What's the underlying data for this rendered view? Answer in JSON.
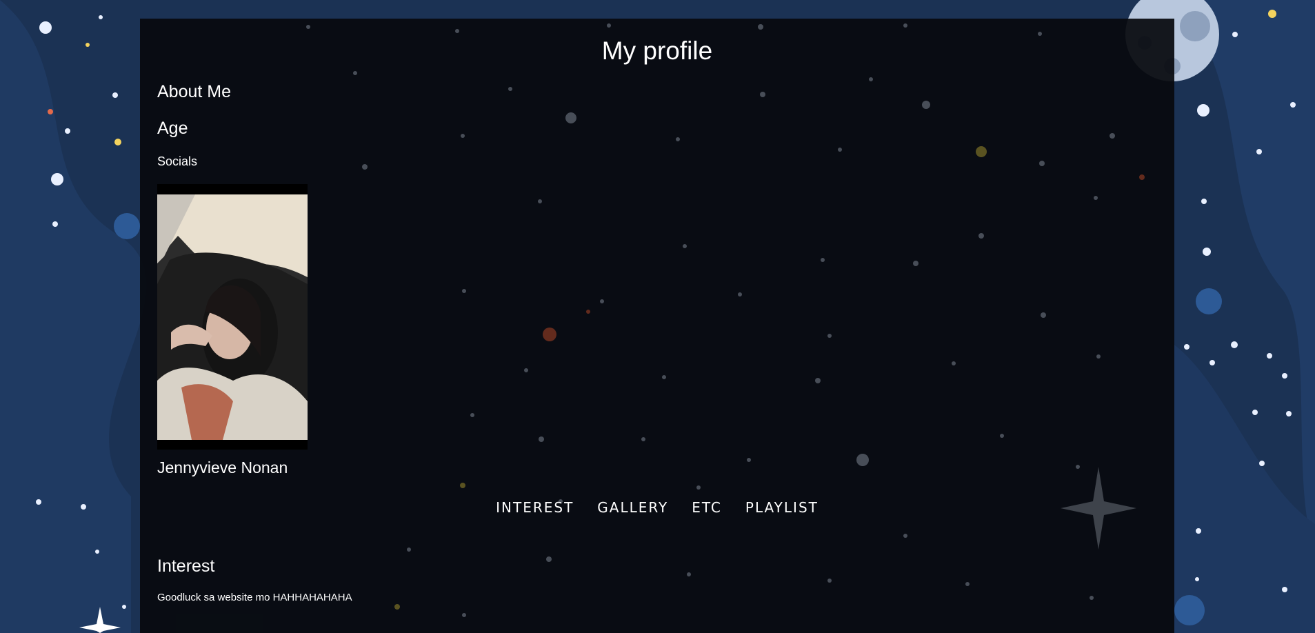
{
  "page": {
    "title": "My profile",
    "background_color": "#1b3254",
    "panel_color": "#080a0e"
  },
  "profile": {
    "about_heading": "About Me",
    "age_heading": "Age",
    "socials_label": "Socials",
    "name": "Jennyvieve Nonan"
  },
  "nav": {
    "items": [
      "INTEREST",
      "GALLERY",
      "ETC",
      "PLAYLIST"
    ]
  },
  "interest": {
    "heading": "Interest",
    "text": "Goodluck sa website mo HAHHAHAHAHA"
  }
}
